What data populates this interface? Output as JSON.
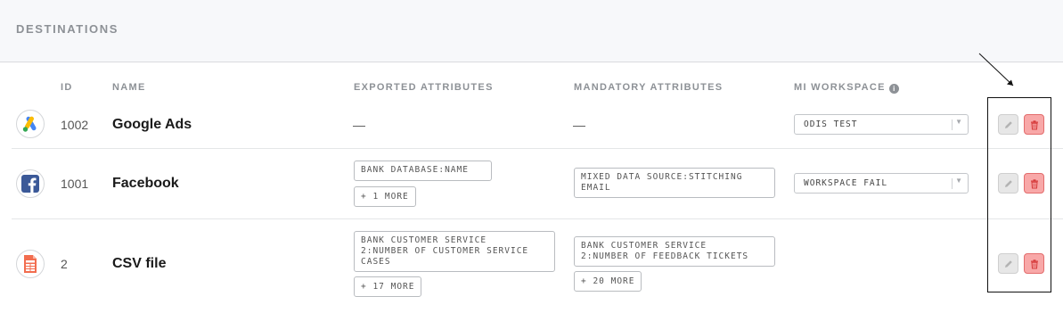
{
  "header": {
    "title": "DESTINATIONS"
  },
  "columns": {
    "id": "ID",
    "name": "NAME",
    "exported": "EXPORTED ATTRIBUTES",
    "mandatory": "MANDATORY ATTRIBUTES",
    "workspace": "MI WORKSPACE",
    "workspace_info_icon": "i"
  },
  "rows": [
    {
      "logo_icon": "google-ads-icon",
      "id": "1002",
      "name": "Google Ads",
      "exported_empty": "—",
      "mandatory_empty": "—",
      "workspace": "ODIS TEST"
    },
    {
      "logo_icon": "facebook-icon",
      "id": "1001",
      "name": "Facebook",
      "exported": [
        "BANK DATABASE:NAME"
      ],
      "exported_more": "+ 1 MORE",
      "mandatory": [
        "MIXED DATA SOURCE:STITCHING\nEMAIL"
      ],
      "workspace": "WORKSPACE FAIL"
    },
    {
      "logo_icon": "csv-file-icon",
      "id": "2",
      "name": "CSV file",
      "exported": [
        "BANK CUSTOMER SERVICE\n2:NUMBER OF CUSTOMER SERVICE\nCASES"
      ],
      "exported_more": "+ 17 MORE",
      "mandatory": [
        "BANK CUSTOMER SERVICE\n2:NUMBER OF FEEDBACK TICKETS"
      ],
      "mandatory_more": "+ 20 MORE"
    }
  ],
  "actions": {
    "edit_icon": "pencil-icon",
    "delete_icon": "trash-icon"
  },
  "colors": {
    "delete_bg": "#f8a8a8",
    "delete_icon": "#d63a3a",
    "edit_bg": "#e7e7e7",
    "header_bg": "#f7f8fa",
    "muted_text": "#8d9196"
  }
}
